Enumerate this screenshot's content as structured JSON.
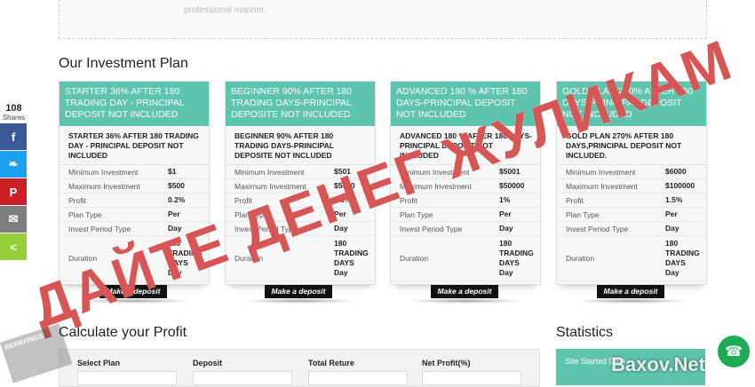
{
  "top_box": {
    "faded_text": "professional manner."
  },
  "investment_title": "Our Investment Plan",
  "plans": [
    {
      "header": "STARTER 36% AFTER 180 TRADING DAY - PRINCIPAL DEPOSIT NOT INCLUDED",
      "desc": "STARTER 36% AFTER 180 TRADING DAY - PRINCIPAL DEPOSIT NOT INCLUDED",
      "min_label": "Minimum Investment",
      "min": "$1",
      "max_label": "Maximum Investment",
      "max": "$500",
      "profit_label": "Profit",
      "profit": "0.2%",
      "type_label": "Plan Type",
      "type": "Per",
      "period_label": "Invest Period Type",
      "period": "Day",
      "duration_label": "Duration",
      "duration": "180 TRADING DAYS Day",
      "button": "Make a deposit"
    },
    {
      "header": "BEGINNER 90% AFTER 180 TRADING DAYS-PRINCIPAL DEPOSITE NOT INCLUDED",
      "desc": "BEGINNER 90% AFTER 180 TRADING DAYS-PRINCIPAL DEPOSITE NOT INCLUDED",
      "min_label": "Minimum Investment",
      "min": "$501",
      "max_label": "Maximum Investment",
      "max": "$5000",
      "profit_label": "Profit",
      "profit": "0.5%",
      "type_label": "Plan Type",
      "type": "Per",
      "period_label": "Invest Period Type",
      "period": "Day",
      "duration_label": "Duration",
      "duration": "180 TRADING DAYS Day",
      "button": "Make a deposit"
    },
    {
      "header": "ADVANCED 180 % AFTER 180 DAYS-PRINCIPAL DEPOSIT NOT INCLUDED",
      "desc": "ADVANCED 180 % AFTER 180 DAYS-PRINCIPAL DEPOSIT NOT INCLUDED",
      "min_label": "Minimum Investment",
      "min": "$5001",
      "max_label": "Maximum Investment",
      "max": "$50000",
      "profit_label": "Profit",
      "profit": "1%",
      "type_label": "Plan Type",
      "type": "Per",
      "period_label": "Invest Period Type",
      "period": "Day",
      "duration_label": "Duration",
      "duration": "180 TRADING DAYS Day",
      "button": "Make a deposit"
    },
    {
      "header": "GOLD PLAN 270% AFTER 180 DAYS-PRINCIPAL DEPOSIT NOT INCLUDED",
      "desc": "GOLD PLAN 270% AFTER 180 DAYS,PRINCIPAL DEPOSIT NOT INCLUDED.",
      "min_label": "Minimum Investment",
      "min": "$6000",
      "max_label": "Maximum Investment",
      "max": "$100000",
      "profit_label": "Profit",
      "profit": "1.5%",
      "type_label": "Plan Type",
      "type": "Per",
      "period_label": "Invest Period Type",
      "period": "Day",
      "duration_label": "Duration",
      "duration": "180 TRADING DAYS Day",
      "button": "Make a deposit"
    }
  ],
  "share": {
    "count": "108",
    "label": "Shares",
    "buttons": [
      {
        "icon": "facebook-icon",
        "glyph": "f",
        "color": "#3b5998"
      },
      {
        "icon": "twitter-icon",
        "glyph": "❧",
        "color": "#1da1f2"
      },
      {
        "icon": "pinterest-icon",
        "glyph": "P",
        "color": "#cb2027"
      },
      {
        "icon": "email-icon",
        "glyph": "✉",
        "color": "#7d7d7d"
      },
      {
        "icon": "share-icon",
        "glyph": "<",
        "color": "#95d03a"
      }
    ]
  },
  "calculator": {
    "title": "Calculate your Profit",
    "col_plan": "Select Plan",
    "col_deposit": "Deposit",
    "col_total": "Total Reture",
    "col_net": "Net Profit(%)"
  },
  "statistics": {
    "title": "Statistics",
    "line1": "Site Started Date"
  },
  "overlay": {
    "text": "ДАЙТЕ ДЕНЕГ ЖУЛИКАМ"
  },
  "watermark": {
    "text": "Baxov.Net"
  },
  "stamp": {
    "text": "REPAYINGS"
  },
  "chat": {
    "glyph": "☎"
  }
}
